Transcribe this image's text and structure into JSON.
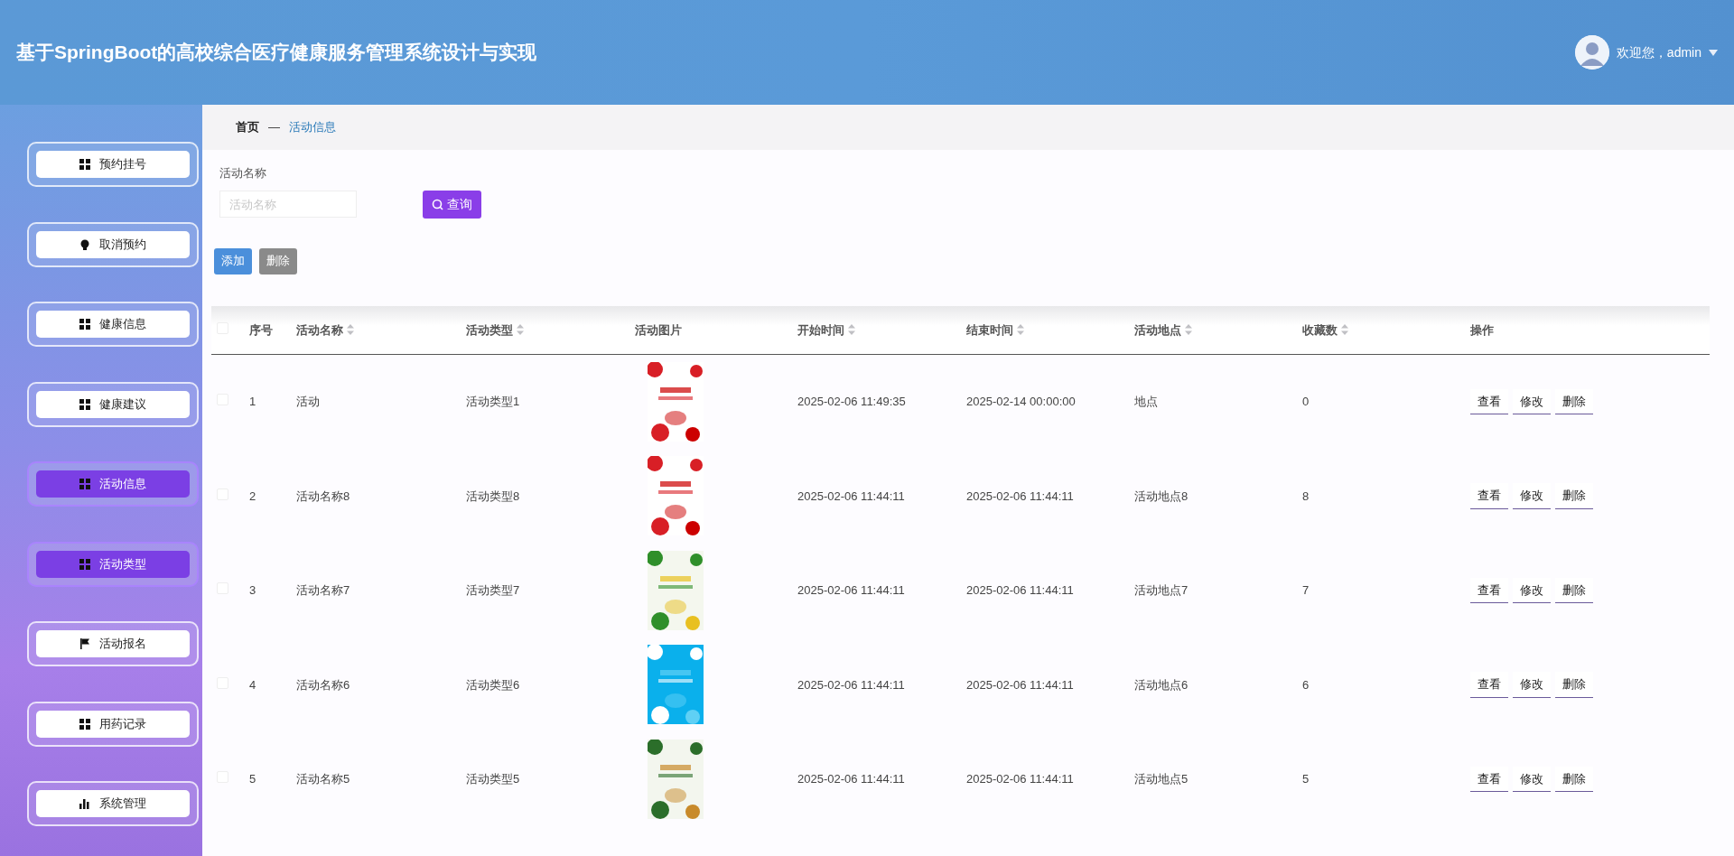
{
  "header": {
    "title": "基于SpringBoot的高校综合医疗健康服务管理系统设计与实现",
    "user": "欢迎您，admin"
  },
  "sidebar": {
    "items": [
      {
        "label": "预约挂号",
        "kind": "grid",
        "selected": false
      },
      {
        "label": "取消预约",
        "kind": "bulb",
        "selected": false
      },
      {
        "label": "健康信息",
        "kind": "grid",
        "selected": false
      },
      {
        "label": "健康建议",
        "kind": "grid",
        "selected": false
      },
      {
        "label": "活动信息",
        "kind": "grid",
        "selected": true
      },
      {
        "label": "活动类型",
        "kind": "grid",
        "selected": true
      },
      {
        "label": "活动报名",
        "kind": "flag",
        "selected": false
      },
      {
        "label": "用药记录",
        "kind": "grid",
        "selected": false
      },
      {
        "label": "系统管理",
        "kind": "chart",
        "selected": false
      }
    ]
  },
  "breadcrumb": [
    "首页",
    "—",
    "活动信息"
  ],
  "search": {
    "label": "活动名称",
    "placeholder": "活动名称",
    "button": "查询"
  },
  "actions": [
    {
      "label": "添加",
      "kind": "primary"
    },
    {
      "label": "删除",
      "kind": "secondary"
    }
  ],
  "table": {
    "header_checked": false,
    "columns": [
      {
        "label": "序号",
        "sortable": false
      },
      {
        "label": "活动名称",
        "sortable": true
      },
      {
        "label": "活动类型",
        "sortable": true
      },
      {
        "label": "活动图片",
        "sortable": false
      },
      {
        "label": "开始时间",
        "sortable": true
      },
      {
        "label": "结束时间",
        "sortable": true
      },
      {
        "label": "活动地点",
        "sortable": true
      },
      {
        "label": "收藏数",
        "sortable": true
      },
      {
        "label": "操作",
        "sortable": false
      }
    ],
    "rows": [
      {
        "checked": false,
        "cells": [
          "1",
          "活动",
          "活动类型1",
          {
            "kind": "picture"
          },
          "2025-02-06 11:49:35",
          "2025-02-14 00:00:00",
          "地点",
          "0"
        ],
        "buttons": [
          "查看",
          "修改",
          "删除"
        ]
      },
      {
        "checked": false,
        "cells": [
          "2",
          "活动名称8",
          "活动类型8",
          {
            "kind": "picture"
          },
          "2025-02-06 11:44:11",
          "2025-02-06 11:44:11",
          "活动地点8",
          "8"
        ],
        "buttons": [
          "查看",
          "修改",
          "删除"
        ]
      },
      {
        "checked": false,
        "cells": [
          "3",
          "活动名称7",
          "活动类型7",
          {
            "kind": "picture"
          },
          "2025-02-06 11:44:11",
          "2025-02-06 11:44:11",
          "活动地点7",
          "7"
        ],
        "buttons": [
          "查看",
          "修改",
          "删除"
        ]
      },
      {
        "checked": false,
        "cells": [
          "4",
          "活动名称6",
          "活动类型6",
          {
            "kind": "picture"
          },
          "2025-02-06 11:44:11",
          "2025-02-06 11:44:11",
          "活动地点6",
          "6"
        ],
        "buttons": [
          "查看",
          "修改",
          "删除"
        ]
      },
      {
        "checked": false,
        "cells": [
          "5",
          "活动名称5",
          "活动类型5",
          {
            "kind": "picture"
          },
          "2025-02-06 11:44:11",
          "2025-02-06 11:44:11",
          "活动地点5",
          "5"
        ],
        "buttons": [
          "查看",
          "修改",
          "删除"
        ]
      }
    ]
  }
}
